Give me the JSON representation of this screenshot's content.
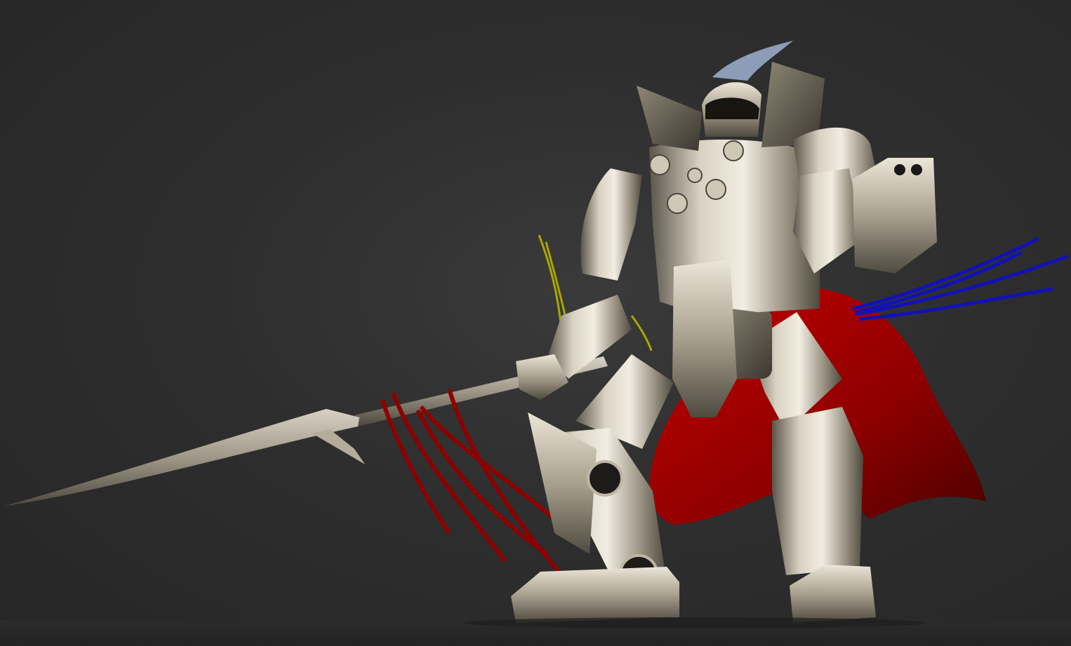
{
  "scene": {
    "subject": "armored-mech-warrior-render",
    "colors": {
      "background": "#2e2e2e",
      "armor_light": "#e6e0d2",
      "armor_mid": "#a9a291",
      "armor_dark": "#4a463d",
      "cape": "#b00000",
      "ribbon_red": "#8a0000",
      "ribbon_blue": "#1010b8",
      "ribbon_yellow": "#b5b000"
    }
  }
}
